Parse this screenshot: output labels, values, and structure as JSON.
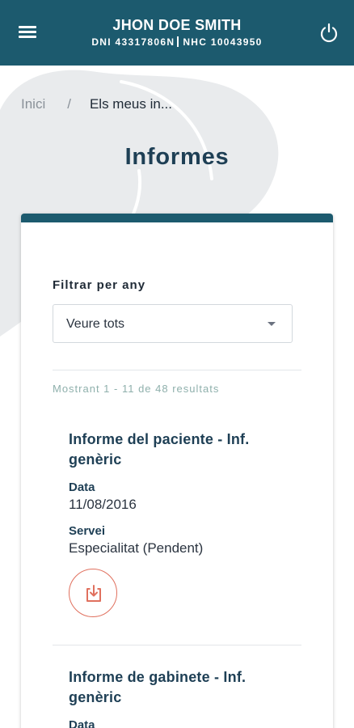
{
  "header": {
    "patient_name": "JHON DOE SMITH",
    "dni_label": "DNI",
    "dni_value": "43317806N",
    "nhc_label": "NHC",
    "nhc_value": "10043950",
    "menu_icon": "hamburger-menu-icon",
    "power_icon": "power-icon"
  },
  "breadcrumb": {
    "home": "Inici",
    "separator": "/",
    "current": "Els meus in..."
  },
  "page": {
    "title": "Informes"
  },
  "filter": {
    "label": "Filtrar per any",
    "selected": "Veure tots"
  },
  "results_text": "Mostrant 1 - 11 de 48 resultats",
  "reports": [
    {
      "title": "Informe del paciente - Inf. genèric",
      "date_label": "Data",
      "date": "11/08/2016",
      "service_label": "Servei",
      "service": "Especialitat (Pendent)",
      "download_icon": "download-icon"
    },
    {
      "title": "Informe de gabinete - Inf. genèric",
      "date_label": "Data"
    }
  ],
  "colors": {
    "header_bg": "#1c5a6e",
    "title_text": "#1e3f55",
    "download_accent": "#e0705e",
    "results_text": "#8fb0ac"
  }
}
